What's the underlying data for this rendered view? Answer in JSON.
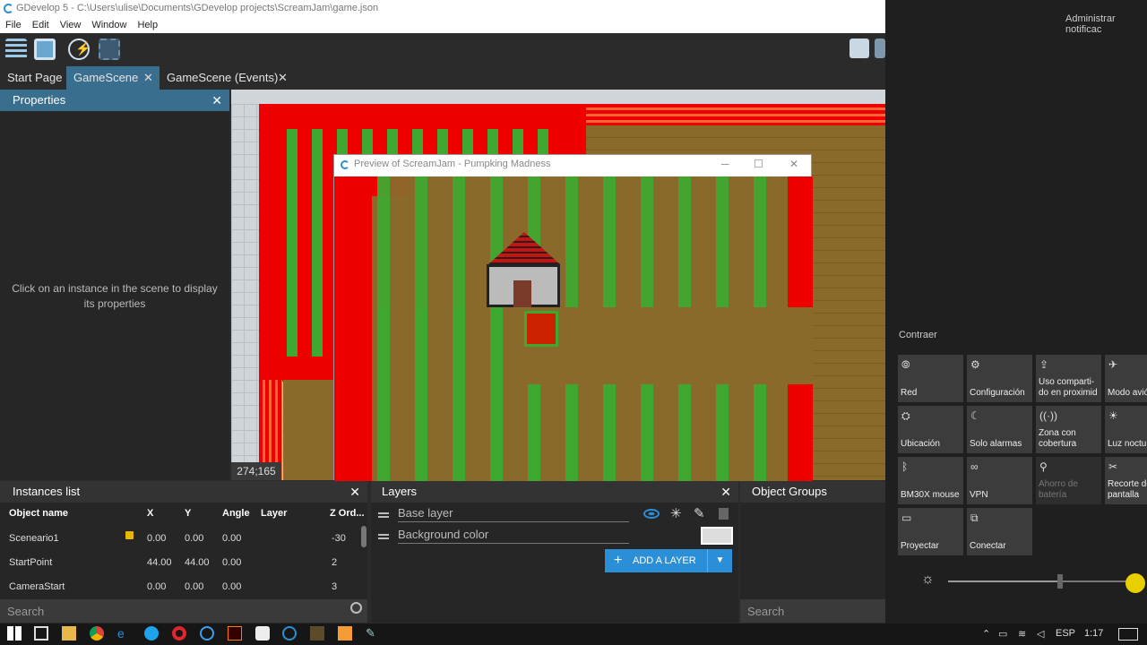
{
  "window": {
    "title": "GDevelop 5 - C:\\Users\\ulise\\Documents\\GDevelop projects\\ScreamJam\\game.json"
  },
  "menu": [
    "File",
    "Edit",
    "View",
    "Window",
    "Help"
  ],
  "tabs": [
    {
      "label": "Start Page"
    },
    {
      "label": "GameScene"
    },
    {
      "label": "GameScene (Events)"
    }
  ],
  "properties": {
    "title": "Properties",
    "message": "Click on an instance in the scene to display its properties"
  },
  "scene": {
    "coords": "274;165"
  },
  "preview": {
    "title": "Preview of ScreamJam - Pumpking Madness"
  },
  "instances": {
    "title": "Instances list",
    "columns": [
      "Object name",
      "X",
      "Y",
      "Angle",
      "Layer",
      "Z Ord..."
    ],
    "rows": [
      {
        "name": "Sceneario1",
        "x": "0.00",
        "y": "0.00",
        "angle": "0.00",
        "layer": "",
        "z": "-30",
        "locked": true
      },
      {
        "name": "StartPoint",
        "x": "44.00",
        "y": "44.00",
        "angle": "0.00",
        "layer": "",
        "z": "2",
        "locked": false
      },
      {
        "name": "CameraStart",
        "x": "0.00",
        "y": "0.00",
        "angle": "0.00",
        "layer": "",
        "z": "3",
        "locked": false
      }
    ],
    "search_placeholder": "Search"
  },
  "layers": {
    "title": "Layers",
    "items": [
      "Base layer",
      "Background color"
    ],
    "add_label": "ADD A LAYER"
  },
  "object_groups": {
    "title": "Object Groups",
    "search_placeholder": "Search"
  },
  "action_center": {
    "manage": "Administrar notificac",
    "collapse": "Contraer",
    "tiles": [
      {
        "label": "Red",
        "icon": "network-icon",
        "enabled": true
      },
      {
        "label": "Configuración",
        "icon": "settings-icon",
        "enabled": true
      },
      {
        "label": "Uso comparti-do en proximid",
        "icon": "share-icon",
        "enabled": true
      },
      {
        "label": "Modo avió",
        "icon": "airplane-icon",
        "enabled": true
      },
      {
        "label": "Ubicación",
        "icon": "location-icon",
        "enabled": true
      },
      {
        "label": "Solo alarmas",
        "icon": "moon-icon",
        "enabled": true
      },
      {
        "label": "Zona con cobertura",
        "icon": "hotspot-icon",
        "enabled": true
      },
      {
        "label": "Luz noctur",
        "icon": "sun-icon",
        "enabled": true
      },
      {
        "label": "BM30X mouse",
        "icon": "bluetooth-icon",
        "enabled": true
      },
      {
        "label": "VPN",
        "icon": "vpn-icon",
        "enabled": true
      },
      {
        "label": "Ahorro de batería",
        "icon": "battery-saver-icon",
        "enabled": false
      },
      {
        "label": "Recorte de pantalla",
        "icon": "snip-icon",
        "enabled": true
      },
      {
        "label": "Proyectar",
        "icon": "project-icon",
        "enabled": true
      },
      {
        "label": "Conectar",
        "icon": "connect-icon",
        "enabled": true
      }
    ]
  },
  "taskbar": {
    "lang": "ESP",
    "time": "1:17"
  },
  "colors": {
    "accent": "#3a6e8f",
    "button": "#2a8fd6",
    "wall": "#ee0000",
    "crop": "#3fa830",
    "soil": "#8a6a2a"
  }
}
